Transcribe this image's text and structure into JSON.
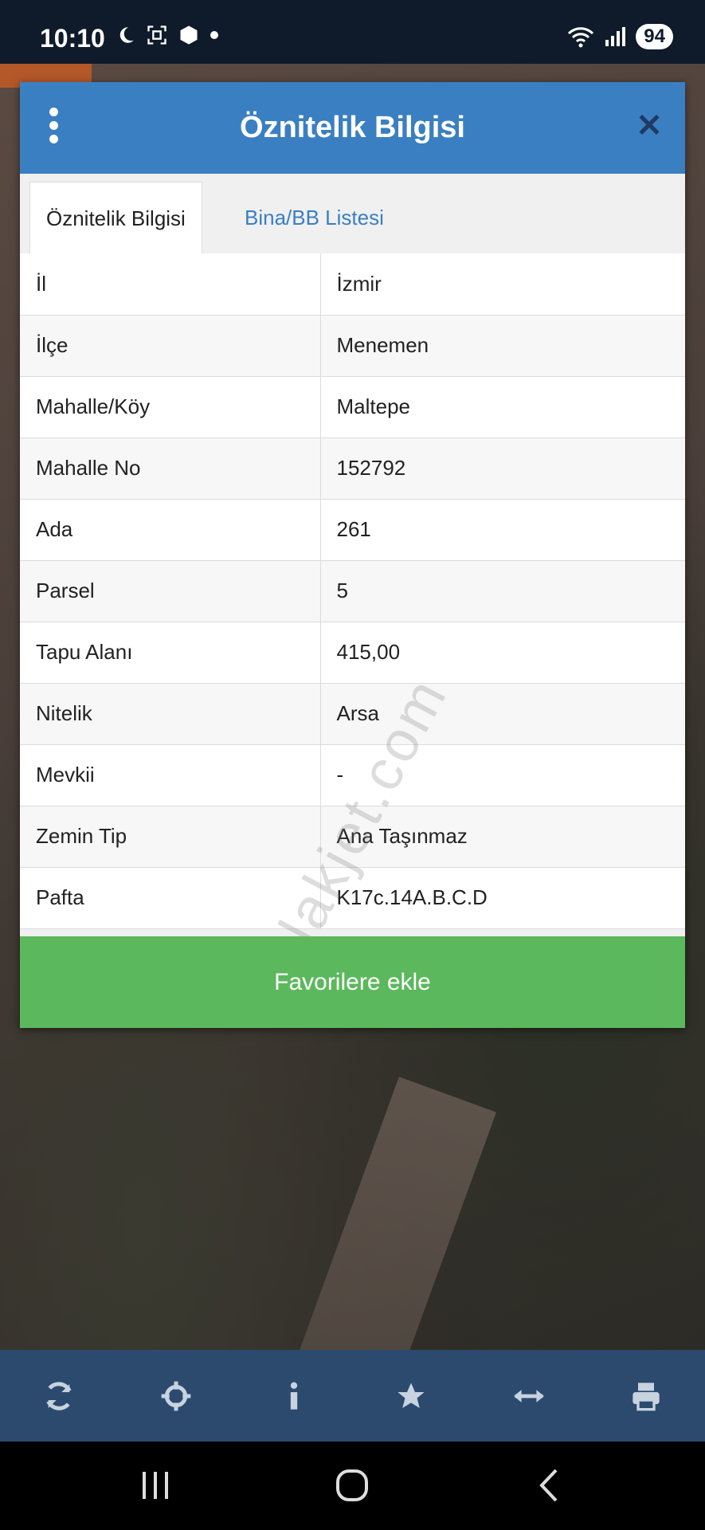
{
  "status_bar": {
    "time": "10:10",
    "battery": "94"
  },
  "dialog": {
    "title": "Öznitelik Bilgisi",
    "tabs": [
      {
        "label": "Öznitelik Bilgisi",
        "active": true
      },
      {
        "label": "Bina/BB Listesi",
        "active": false
      }
    ],
    "rows": [
      {
        "key": "İl",
        "value": "İzmir"
      },
      {
        "key": "İlçe",
        "value": "Menemen"
      },
      {
        "key": "Mahalle/Köy",
        "value": "Maltepe"
      },
      {
        "key": "Mahalle No",
        "value": "152792"
      },
      {
        "key": "Ada",
        "value": "261"
      },
      {
        "key": "Parsel",
        "value": "5"
      },
      {
        "key": "Tapu Alanı",
        "value": "415,00"
      },
      {
        "key": "Nitelik",
        "value": "Arsa"
      },
      {
        "key": "Mevkii",
        "value": "-"
      },
      {
        "key": "Zemin Tip",
        "value": "Ana Taşınmaz"
      },
      {
        "key": "Pafta",
        "value": "K17c.14A.B.C.D"
      }
    ],
    "favorite_button": "Favorilere ekle"
  },
  "watermark": "emlakjet.com",
  "toolbar": {
    "icons": [
      "refresh-icon",
      "crosshair-icon",
      "info-icon",
      "star-icon",
      "measure-icon",
      "print-icon"
    ]
  },
  "colors": {
    "header": "#3a7fc1",
    "button": "#5cb85c",
    "toolbar": "#2b4a6e"
  }
}
